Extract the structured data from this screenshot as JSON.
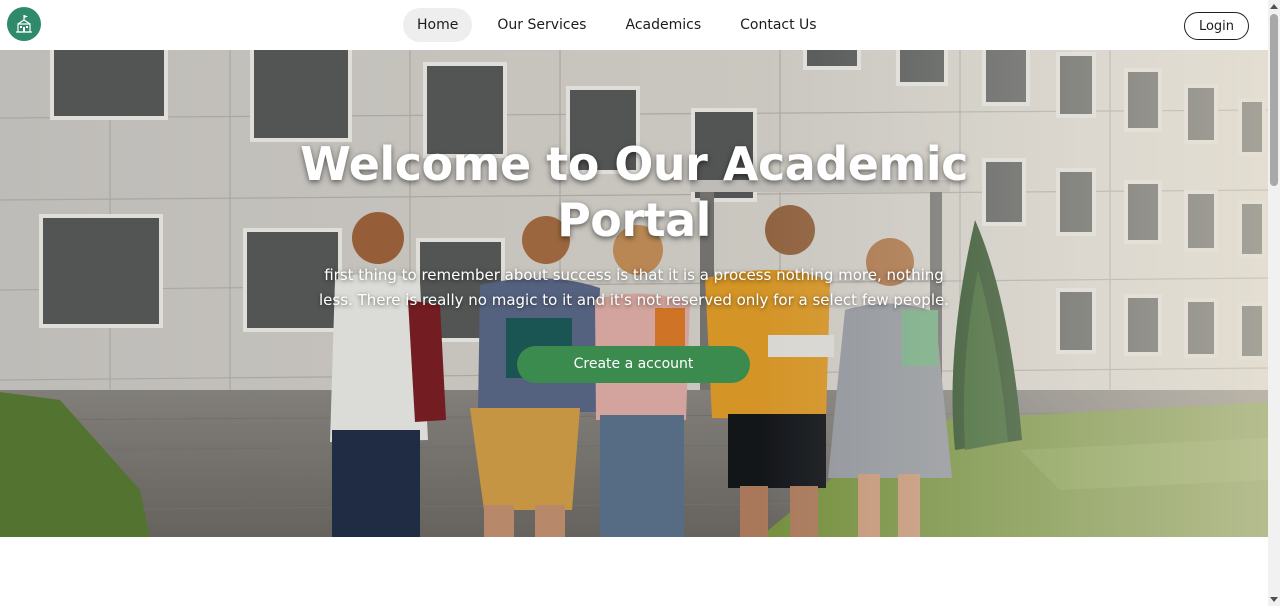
{
  "header": {
    "logo_icon": "school-building-icon",
    "nav": [
      {
        "label": "Home",
        "active": true
      },
      {
        "label": "Our Services",
        "active": false
      },
      {
        "label": "Academics",
        "active": false
      },
      {
        "label": "Contact Us",
        "active": false
      }
    ],
    "login_label": "Login"
  },
  "hero": {
    "title_line1": "Welcome to Our Academic",
    "title_line2": "Portal",
    "subtitle_line1": "first thing to remember about success is that it is a process nothing more, nothing",
    "subtitle_line2": "less. There is really no magic to it and it's not reserved only for a select few people.",
    "cta_label": "Create a account"
  },
  "colors": {
    "brand_logo": "#2e8a6a",
    "cta": "#3c8b4e",
    "active_nav": "#eeeeee"
  }
}
